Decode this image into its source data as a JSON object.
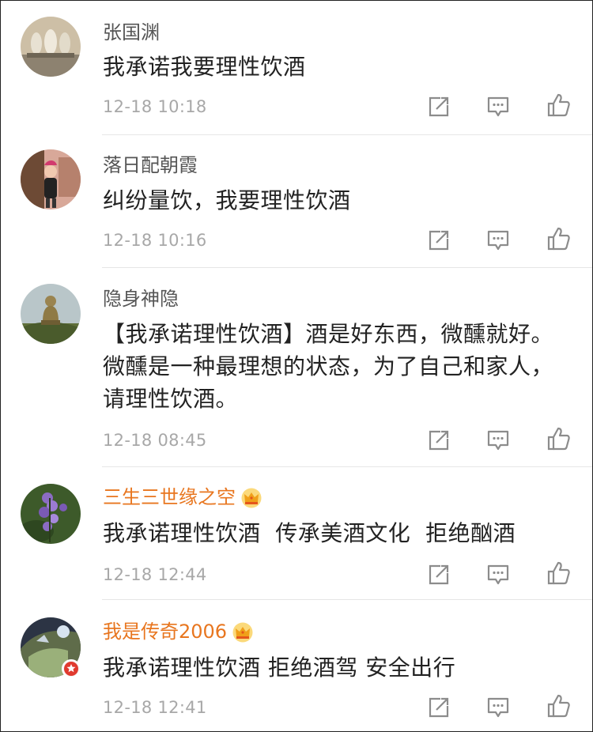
{
  "comments": [
    {
      "name": "张国渊",
      "text": "我承诺我要理性饮酒",
      "time": "12-18 10:18",
      "vip": false,
      "avatar_colors": [
        "#8d8270",
        "#cdbfa6"
      ]
    },
    {
      "name": "落日配朝霞",
      "text": "纠纷量饮，我要理性饮酒",
      "time": "12-18 10:16",
      "vip": false,
      "avatar_colors": [
        "#6d4a35",
        "#d8a899"
      ]
    },
    {
      "name": "隐身神隐",
      "text": "【我承诺理性饮酒】酒是好东西，微醺就好。微醺是一种最理想的状态，为了自己和家人，请理性饮酒。",
      "time": "12-18 08:45",
      "vip": false,
      "avatar_colors": [
        "#b9c6c9",
        "#8f7a45"
      ]
    },
    {
      "name": "三生三世缘之空",
      "text": "我承诺理性饮酒  传承美酒文化  拒绝酗酒",
      "time": "12-18 12:44",
      "vip": true,
      "avatar_colors": [
        "#3d5a2a",
        "#8b6cc4"
      ]
    },
    {
      "name": "我是传奇2006",
      "text": "我承诺理性饮酒 拒绝酒驾 安全出行",
      "time": "12-18 12:41",
      "vip": true,
      "avatar_colors": [
        "#2c3444",
        "#9ab07a"
      ]
    }
  ],
  "icons": {
    "repost": "repost-icon",
    "comment": "comment-icon",
    "like": "like-icon",
    "crown": "vip-crown-icon"
  },
  "colors": {
    "vip_name": "#e8761f",
    "text": "#222222",
    "meta": "#a8a8a8",
    "icon": "#8c8c8c"
  }
}
